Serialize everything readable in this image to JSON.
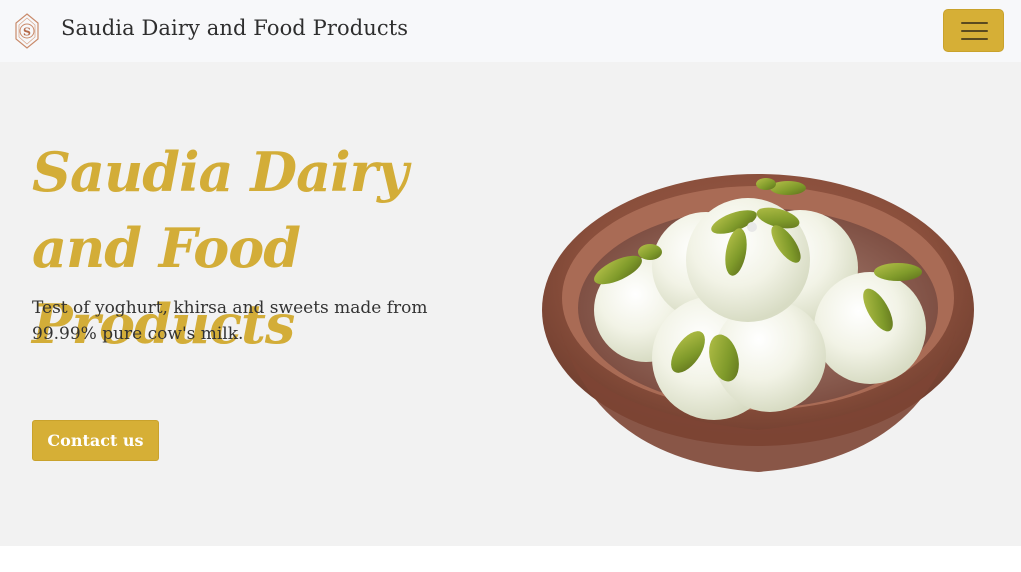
{
  "navbar": {
    "brand_name": "Saudia Dairy and Food Products",
    "logo_letter": "S",
    "menu_icon": "hamburger-menu-icon"
  },
  "hero": {
    "title": "Saudia Dairy and Food Products",
    "description": "Test of yoghurt, khirsa and sweets made from 99.99% pure cow's milk.",
    "contact_label": "Contact us",
    "image": "bowl of rasgulla sweets with pistachio in clay pot"
  },
  "colors": {
    "accent": "#d6af36",
    "title_gold": "#d3ad38",
    "navbar_bg": "#f7f8fa",
    "hero_bg": "#f2f2f2",
    "text": "#333333"
  }
}
